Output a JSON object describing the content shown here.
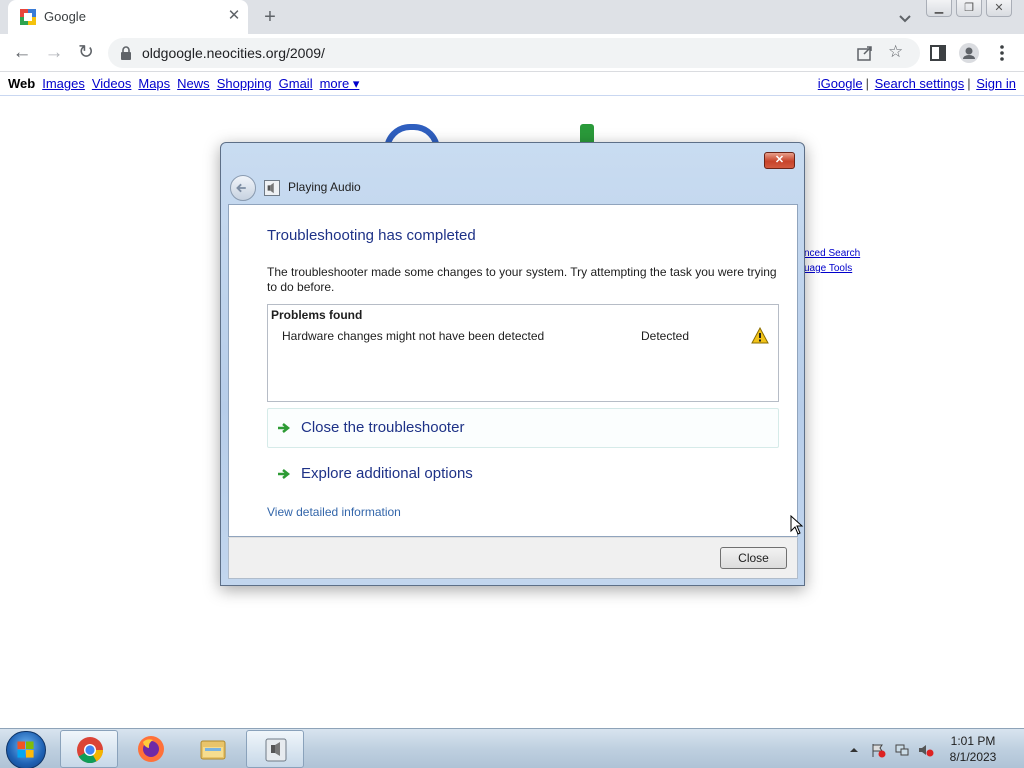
{
  "browser": {
    "tab_title": "Google",
    "url": "oldgoogle.neocities.org/2009/"
  },
  "google": {
    "nav_left": [
      "Web",
      "Images",
      "Videos",
      "Maps",
      "News",
      "Shopping",
      "Gmail",
      "more ▾"
    ],
    "nav_right": [
      "iGoogle",
      "Search settings",
      "Sign in"
    ],
    "side_links": [
      "nced Search",
      "uage Tools"
    ]
  },
  "dialog": {
    "window_title": "Playing Audio",
    "heading": "Troubleshooting has completed",
    "description": "The troubleshooter made some changes to your system. Try attempting the task you were trying to do before.",
    "problems_header": "Problems found",
    "problems": [
      {
        "name": "Hardware changes might not have been detected",
        "status": "Detected",
        "icon": "warning-icon"
      }
    ],
    "commands": [
      "Close the troubleshooter",
      "Explore additional options"
    ],
    "detail_link": "View detailed information",
    "close_button": "Close",
    "close_x": "✕"
  },
  "taskbar": {
    "time": "1:01 PM",
    "date": "8/1/2023"
  },
  "colors": {
    "heading": "#1e3287",
    "link": "#0000cc",
    "warning": "#f2c318"
  }
}
